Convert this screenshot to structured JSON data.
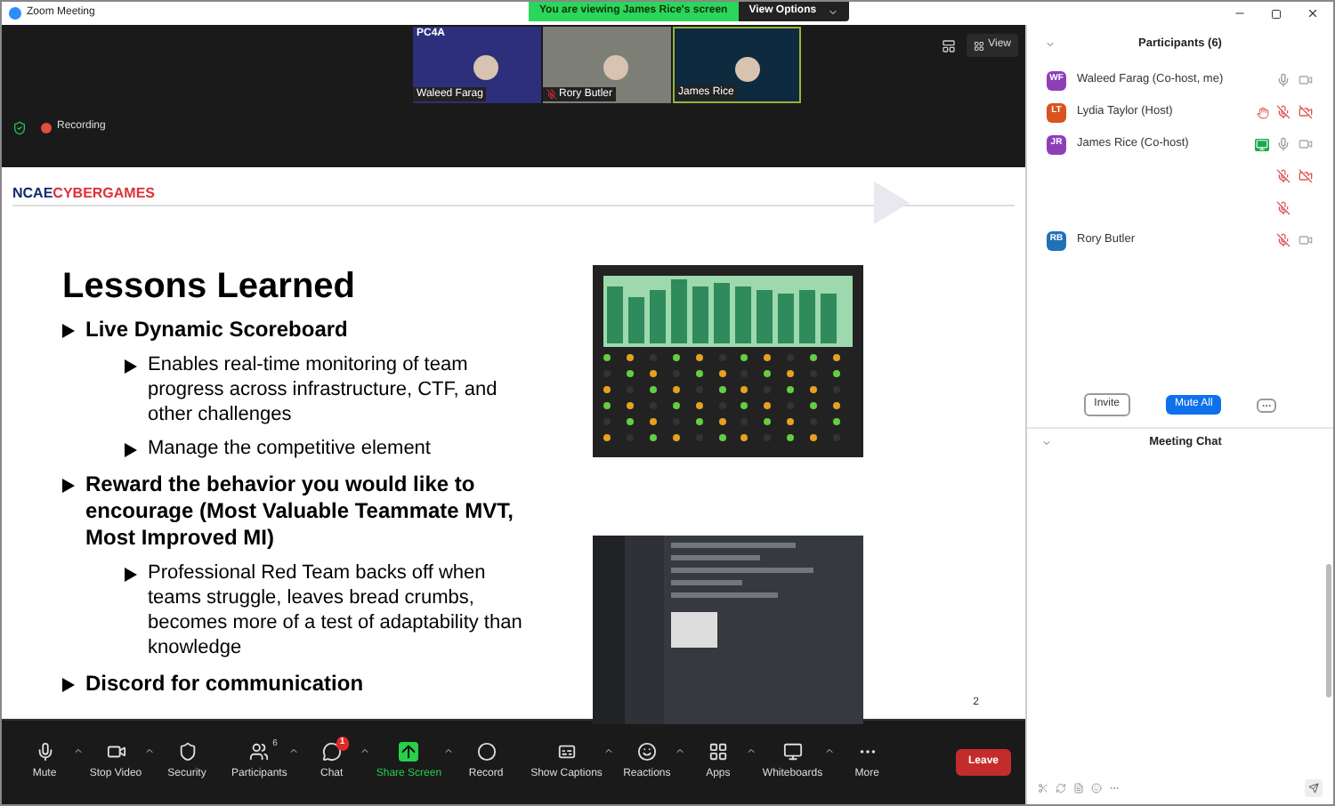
{
  "window": {
    "title": "Zoom Meeting"
  },
  "share_banner": {
    "text": "You are viewing James Rice's screen",
    "options_label": "View Options"
  },
  "video_strip": [
    {
      "name": "Waleed Farag",
      "muted": false,
      "logo": "PC4A"
    },
    {
      "name": "Rory Butler",
      "muted": true
    },
    {
      "name": "James Rice",
      "muted": false
    }
  ],
  "view_button": "View",
  "recording": {
    "label": "Recording"
  },
  "slide": {
    "logo_left": "NCAE",
    "logo_right": "CYBERGAMES",
    "title": "Lessons Learned",
    "page": "2",
    "bullets": [
      {
        "text": "Live Dynamic Scoreboard",
        "children": [
          {
            "text": "Enables real-time monitoring of team progress across infrastructure, CTF, and other challenges"
          },
          {
            "text": "Manage the competitive element"
          }
        ]
      },
      {
        "text": "Reward the behavior you would like to encourage (Most Valuable Teammate MVT, Most Improved MI)",
        "children": [
          {
            "text": "Professional Red Team backs off when teams struggle, leaves bread crumbs, becomes more of a test of adaptability than knowledge"
          }
        ]
      },
      {
        "text": "Discord for communication"
      }
    ]
  },
  "toolbar": [
    {
      "kind": "mic",
      "label": "Mute",
      "caret": true
    },
    {
      "kind": "video",
      "label": "Stop Video",
      "caret": true
    },
    {
      "kind": "security",
      "label": "Security",
      "caret": false
    },
    {
      "kind": "participants",
      "label": "Participants",
      "count": "6",
      "caret": true
    },
    {
      "kind": "chat",
      "label": "Chat",
      "badge": "1",
      "caret": true
    },
    {
      "kind": "share",
      "label": "Share Screen",
      "caret": true
    },
    {
      "kind": "record",
      "label": "Record",
      "caret": false
    },
    {
      "kind": "captions",
      "label": "Show Captions",
      "caret": true
    },
    {
      "kind": "reactions",
      "label": "Reactions",
      "caret": true
    },
    {
      "kind": "apps",
      "label": "Apps",
      "caret": true
    },
    {
      "kind": "whiteboard",
      "label": "Whiteboards",
      "caret": true
    },
    {
      "kind": "more",
      "label": "More",
      "caret": false
    }
  ],
  "leave_button": "Leave",
  "participants_panel": {
    "title": "Participants (6)",
    "items": [
      {
        "initials": "WF",
        "name": "Waleed Farag (Co-host, me)",
        "color": "#8e3fb8",
        "muted": false,
        "video_off": false,
        "sharing": false,
        "raised": false
      },
      {
        "initials": "LT",
        "name": "Lydia Taylor (Host)",
        "color": "#d9541e",
        "muted": true,
        "video_off": true,
        "sharing": false,
        "raised": true
      },
      {
        "initials": "JR",
        "name": "James Rice (Co-host)",
        "color": "#8e3fb8",
        "muted": false,
        "video_off": false,
        "sharing": true,
        "raised": false
      },
      {
        "muted": true,
        "video_off": true,
        "sharing": false,
        "raised": false
      },
      {
        "muted": true,
        "sharing": false,
        "raised": false
      },
      {
        "initials": "RB",
        "name": "Rory Butler",
        "color": "#2170b8",
        "muted": true,
        "video_off": false,
        "sharing": false,
        "raised": false
      }
    ],
    "buttons": [
      "Invite",
      "Mute All"
    ]
  },
  "chat_panel": {
    "title": "Meeting Chat"
  }
}
